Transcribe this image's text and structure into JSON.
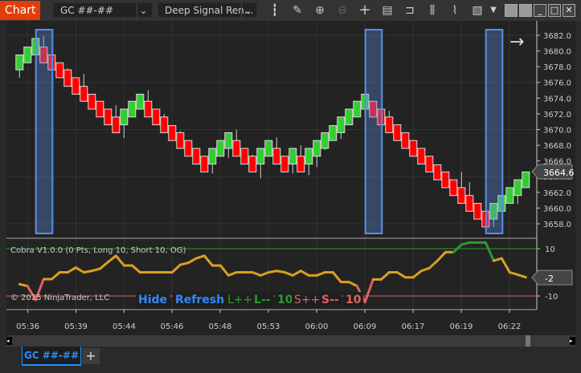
{
  "window": {
    "title": "Chart",
    "instrument": "GC ##-##",
    "template": "Deep Signal Ren..."
  },
  "toolbar_icons": [
    "bar-type-icon",
    "pencil-icon",
    "zoom-in-icon",
    "zoom-out-icon",
    "crosshair-icon",
    "data-box-icon",
    "properties-icon",
    "indicators-icon",
    "strategies-icon",
    "chart-trader-icon",
    "more-dropdown-icon"
  ],
  "window_controls": [
    "tile-icon",
    "tile2-icon",
    "minimize-icon",
    "maximize-icon",
    "close-icon"
  ],
  "colors": {
    "up": "#33cc33",
    "down": "#ff0000",
    "osc": "#d9a020",
    "osc_high": "#2e9a2e",
    "osc_low": "#e06060",
    "highlight": "#5b8fe6",
    "accent": "#e23e0b"
  },
  "price_axis": {
    "labels": [
      "3682.0",
      "3680.0",
      "3678.0",
      "3676.0",
      "3674.0",
      "3672.0",
      "3670.0",
      "3668.0",
      "3666.0",
      "3664.0",
      "3662.0",
      "3660.0",
      "3658.0"
    ],
    "last_price": "3664.6"
  },
  "time_axis": {
    "labels": [
      "05:36",
      "05:39",
      "05:44",
      "05:46",
      "05:48",
      "05:53",
      "06:00",
      "06:09",
      "06:17",
      "06:19",
      "06:22"
    ]
  },
  "chart_data": {
    "type": "candlestick",
    "bars": [
      [
        3677.6,
        3679.5,
        3677.6,
        3679.5,
        3676.6
      ],
      [
        3678.5,
        3680.5,
        3678.5,
        3680.5,
        3678.5
      ],
      [
        3679.5,
        3681.6,
        3679.5,
        3681.6,
        3679.5
      ],
      [
        3680.5,
        3678.5,
        3681.9,
        3678.5,
        3678.5
      ],
      [
        3679.5,
        3677.6,
        3679.5,
        3677.6,
        3677.6
      ],
      [
        3678.5,
        3676.6,
        3678.5,
        3676.6,
        3676.6
      ],
      [
        3677.6,
        3675.5,
        3677.8,
        3675.5,
        3675.5
      ],
      [
        3676.6,
        3674.5,
        3676.6,
        3674.5,
        3674.5
      ],
      [
        3675.5,
        3673.6,
        3677.1,
        3673.6,
        3673.6
      ],
      [
        3674.5,
        3672.6,
        3674.5,
        3672.6,
        3672.6
      ],
      [
        3673.6,
        3671.6,
        3673.6,
        3671.6,
        3671.6
      ],
      [
        3672.6,
        3670.6,
        3672.6,
        3670.6,
        3670.6
      ],
      [
        3671.6,
        3669.6,
        3673.1,
        3669.6,
        3669.6
      ],
      [
        3670.6,
        3672.6,
        3672.6,
        3670.6,
        3668.9
      ],
      [
        3671.6,
        3673.6,
        3673.6,
        3671.6,
        3671.6
      ],
      [
        3672.6,
        3674.5,
        3674.5,
        3672.6,
        3672.6
      ],
      [
        3673.6,
        3671.6,
        3675.0,
        3671.6,
        3671.6
      ],
      [
        3672.6,
        3670.6,
        3672.6,
        3670.6,
        3670.6
      ],
      [
        3671.6,
        3669.6,
        3672.0,
        3669.6,
        3669.6
      ],
      [
        3670.5,
        3668.6,
        3670.5,
        3668.6,
        3668.6
      ],
      [
        3669.6,
        3667.6,
        3669.8,
        3667.6,
        3667.6
      ],
      [
        3668.6,
        3666.6,
        3668.6,
        3666.6,
        3666.6
      ],
      [
        3667.6,
        3665.6,
        3667.6,
        3665.6,
        3665.6
      ],
      [
        3666.6,
        3664.6,
        3666.6,
        3664.6,
        3664.6
      ],
      [
        3665.6,
        3667.6,
        3667.6,
        3665.6,
        3664.4
      ],
      [
        3666.6,
        3668.6,
        3668.6,
        3666.6,
        3666.6
      ],
      [
        3667.6,
        3669.6,
        3669.6,
        3667.6,
        3666.4
      ],
      [
        3668.6,
        3666.6,
        3670.0,
        3666.6,
        3666.6
      ],
      [
        3667.6,
        3665.6,
        3667.6,
        3665.6,
        3665.6
      ],
      [
        3666.6,
        3664.6,
        3666.8,
        3664.6,
        3664.6
      ],
      [
        3665.6,
        3667.6,
        3667.6,
        3665.6,
        3663.8
      ],
      [
        3666.6,
        3668.6,
        3668.6,
        3666.6,
        3666.6
      ],
      [
        3667.6,
        3665.6,
        3669.0,
        3665.6,
        3665.6
      ],
      [
        3666.6,
        3664.6,
        3666.6,
        3664.6,
        3664.6
      ],
      [
        3665.6,
        3667.6,
        3667.6,
        3665.6,
        3664.4
      ],
      [
        3666.6,
        3664.6,
        3668.0,
        3664.6,
        3664.6
      ],
      [
        3665.6,
        3667.6,
        3667.6,
        3665.6,
        3664.2
      ],
      [
        3666.6,
        3668.6,
        3668.6,
        3666.6,
        3665.2
      ],
      [
        3667.6,
        3669.6,
        3669.6,
        3667.6,
        3667.4
      ],
      [
        3668.6,
        3670.5,
        3670.5,
        3668.6,
        3668.6
      ],
      [
        3669.6,
        3671.6,
        3671.6,
        3669.6,
        3668.8
      ],
      [
        3670.6,
        3672.6,
        3672.6,
        3670.6,
        3670.6
      ],
      [
        3671.6,
        3673.6,
        3673.6,
        3671.6,
        3671.6
      ],
      [
        3672.6,
        3674.5,
        3674.5,
        3672.6,
        3671.6
      ],
      [
        3673.6,
        3671.6,
        3673.6,
        3671.6,
        3671.6
      ],
      [
        3672.6,
        3670.6,
        3672.6,
        3670.6,
        3670.6
      ],
      [
        3671.6,
        3669.6,
        3672.4,
        3669.6,
        3669.6
      ],
      [
        3670.6,
        3668.6,
        3670.6,
        3668.6,
        3668.6
      ],
      [
        3669.6,
        3667.6,
        3669.6,
        3667.6,
        3667.6
      ],
      [
        3668.6,
        3666.6,
        3668.6,
        3666.6,
        3666.6
      ],
      [
        3667.6,
        3665.6,
        3667.6,
        3665.6,
        3665.6
      ],
      [
        3666.6,
        3664.6,
        3666.6,
        3664.6,
        3664.6
      ],
      [
        3665.5,
        3663.6,
        3665.5,
        3663.6,
        3663.6
      ],
      [
        3664.6,
        3662.6,
        3664.6,
        3662.6,
        3662.6
      ],
      [
        3663.6,
        3661.6,
        3663.6,
        3661.6,
        3661.6
      ],
      [
        3662.6,
        3660.6,
        3664.6,
        3660.6,
        3660.6
      ],
      [
        3661.6,
        3659.6,
        3663.3,
        3659.6,
        3659.6
      ],
      [
        3660.6,
        3658.6,
        3660.6,
        3658.6,
        3658.6
      ],
      [
        3659.6,
        3657.6,
        3659.6,
        3657.6,
        3657.6
      ],
      [
        3658.6,
        3660.6,
        3660.6,
        3658.6,
        3657.6
      ],
      [
        3659.6,
        3661.6,
        3661.6,
        3659.6,
        3659.6
      ],
      [
        3660.6,
        3662.6,
        3662.6,
        3660.6,
        3660.6
      ],
      [
        3661.6,
        3663.6,
        3663.6,
        3661.6,
        3660.5
      ],
      [
        3662.6,
        3664.6,
        3664.6,
        3662.6,
        3662.6
      ]
    ],
    "bar_fields": [
      "open",
      "close",
      "high",
      "body_low",
      "low"
    ],
    "highlighted_bars": [
      3,
      44,
      59
    ],
    "ylim": [
      3656.5,
      3683.5
    ],
    "indicator": {
      "label": "Cobra V1.0.0 (0 Pts, Long 10, Short 10, OG)",
      "levels": [
        10,
        -10
      ],
      "level_labels": [
        "10",
        "-10"
      ],
      "last_value": "-2",
      "ylim": [
        -17,
        19
      ],
      "values": [
        -5,
        -5.8,
        -11.7,
        -2.9,
        -2.9,
        0,
        0,
        2,
        0,
        0.6,
        1.5,
        4.3,
        7,
        2.9,
        2.9,
        0,
        0,
        0,
        0,
        0,
        3.2,
        4,
        5.9,
        7,
        2.9,
        2.9,
        -1.3,
        0,
        0,
        0,
        -1.3,
        0,
        0.6,
        0,
        -1.3,
        0.6,
        -1.3,
        -1.3,
        0,
        0,
        -4.1,
        -4.1,
        -5.8,
        -12.6,
        -3,
        -3,
        0,
        0,
        -2.1,
        -2.1,
        0.6,
        1.8,
        4.9,
        8.5,
        8.5,
        11.7,
        12.6,
        12.6,
        12.6,
        4.9,
        5.9,
        0,
        -1,
        -2.1
      ]
    }
  },
  "copyright": "© 2025 NinjaTrader, LLC",
  "overlay_buttons": {
    "hide": "Hide",
    "refresh": "Refresh",
    "long_plus": "L++",
    "long_minus": "L--",
    "long_qty": "10",
    "short_plus": "S++",
    "short_minus": "S--",
    "short_qty": "10"
  },
  "tabs": [
    {
      "label": "GC ##-##"
    }
  ],
  "add_tab": "+"
}
